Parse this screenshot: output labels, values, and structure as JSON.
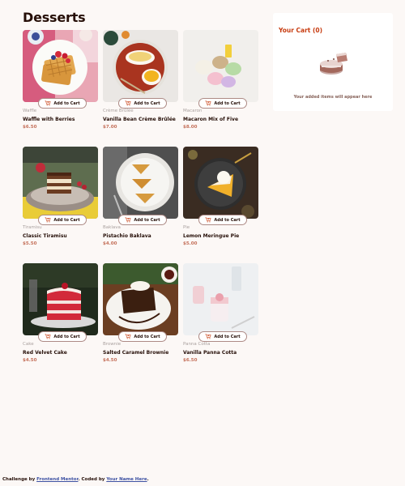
{
  "page": {
    "title": "Desserts"
  },
  "products": [
    {
      "category": "Waffle",
      "name": "Waffle with Berries",
      "price": "$6.50",
      "button": "Add to Cart"
    },
    {
      "category": "Crème Brûlée",
      "name": "Vanilla Bean Crème Brûlée",
      "price": "$7.00",
      "button": "Add to Cart"
    },
    {
      "category": "Macaron",
      "name": "Macaron Mix of Five",
      "price": "$8.00",
      "button": "Add to Cart"
    },
    {
      "category": "Tiramisu",
      "name": "Classic Tiramisu",
      "price": "$5.50",
      "button": "Add to Cart"
    },
    {
      "category": "Baklava",
      "name": "Pistachio Baklava",
      "price": "$4.00",
      "button": "Add to Cart"
    },
    {
      "category": "Pie",
      "name": "Lemon Meringue Pie",
      "price": "$5.00",
      "button": "Add to Cart"
    },
    {
      "category": "Cake",
      "name": "Red Velvet Cake",
      "price": "$4.50",
      "button": "Add to Cart"
    },
    {
      "category": "Brownie",
      "name": "Salted Caramel Brownie",
      "price": "$4.50",
      "button": "Add to Cart"
    },
    {
      "category": "Panna Cotta",
      "name": "Vanilla Panna Cotta",
      "price": "$6.50",
      "button": "Add to Cart"
    }
  ],
  "cart": {
    "title": "Your Cart (0)",
    "empty_message": "Your added items will appear here"
  },
  "footer": {
    "prefix": "Challenge by",
    "mentor_link": "Frontend Mentor",
    "middle": ". Coded by",
    "author_link": "Your Name Here",
    "suffix": "."
  },
  "icons": {
    "cart": "add-to-cart-icon",
    "empty": "empty-cart-illustration"
  },
  "colors": {
    "background": "#fcf8f6",
    "accent": "#c73b0f",
    "price": "#c4705a",
    "text": "#260f08"
  }
}
